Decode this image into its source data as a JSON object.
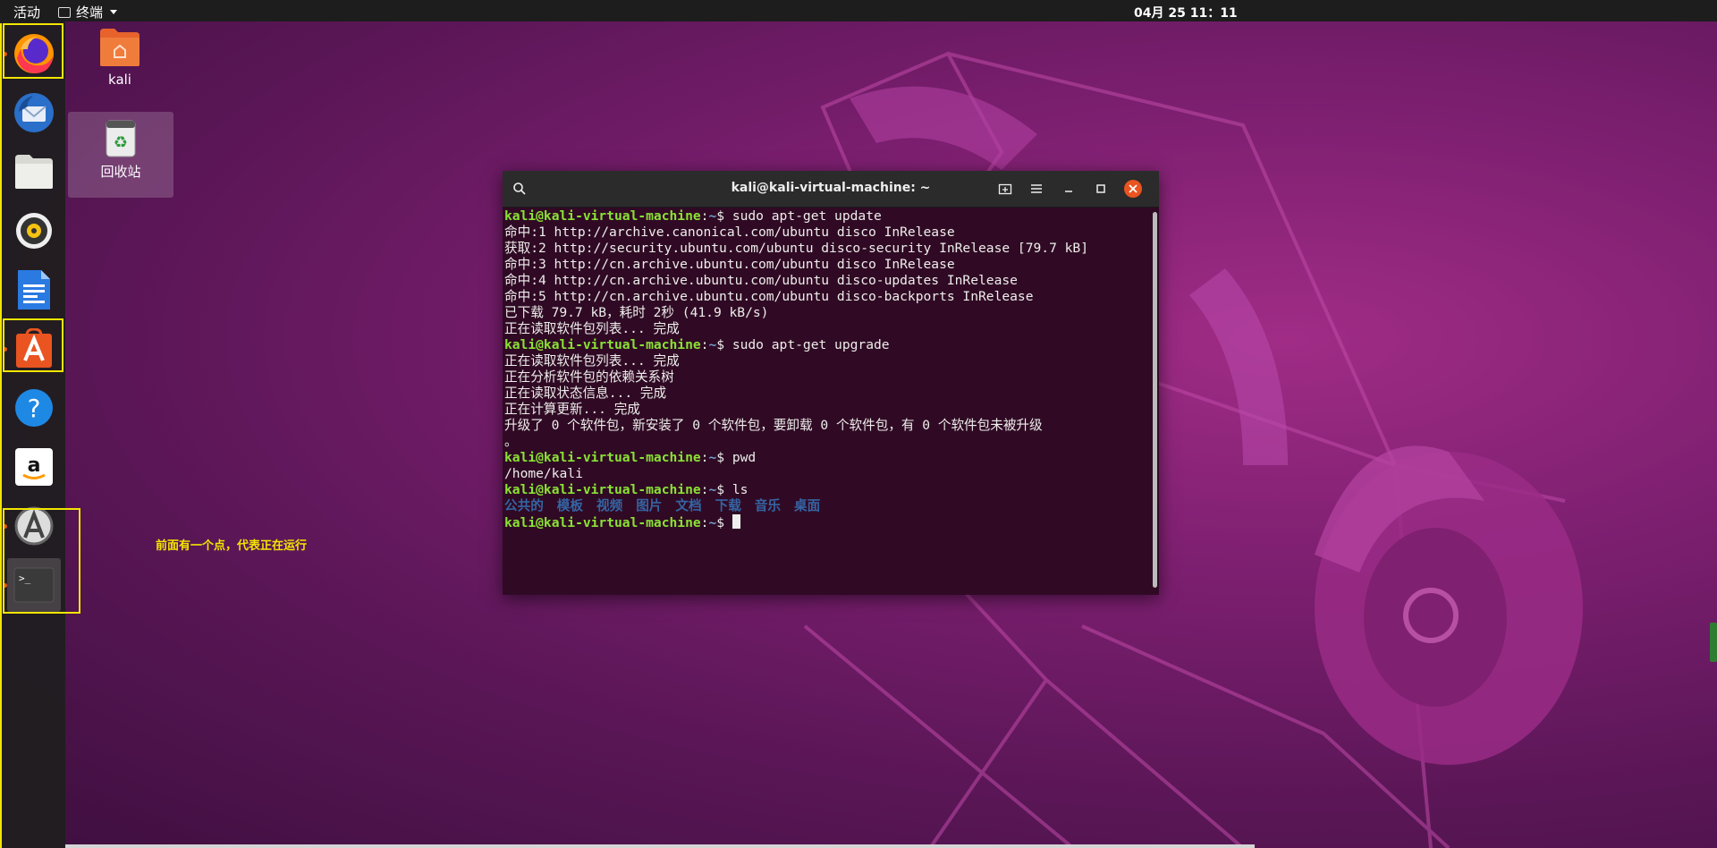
{
  "topbar": {
    "activities": "活动",
    "app_menu": "终端",
    "clock": "04月 25  11：11"
  },
  "dock": {
    "items": [
      {
        "name": "firefox",
        "icon": "firefox-icon",
        "running": true
      },
      {
        "name": "thunderbird",
        "icon": "thunderbird-icon",
        "running": false
      },
      {
        "name": "files",
        "icon": "folder-icon",
        "running": false
      },
      {
        "name": "rhythmbox",
        "icon": "rhythmbox-icon",
        "running": false
      },
      {
        "name": "libreoffice-writer",
        "icon": "writer-icon",
        "running": false
      },
      {
        "name": "ubuntu-software",
        "icon": "software-center-icon",
        "running": true
      },
      {
        "name": "help",
        "icon": "help-icon",
        "running": false
      },
      {
        "name": "amazon",
        "icon": "amazon-icon",
        "running": false
      },
      {
        "name": "software-updater",
        "icon": "updater-icon",
        "running": true
      },
      {
        "name": "terminal",
        "icon": "terminal-icon",
        "running": true
      }
    ]
  },
  "desktop": {
    "icons": [
      {
        "label": "kali",
        "icon": "home-folder-icon"
      },
      {
        "label": "回收站",
        "icon": "trash-icon"
      }
    ],
    "annotation": "前面有一个点，代表正在运行"
  },
  "terminal": {
    "title": "kali@kali-virtual-machine: ~",
    "prompt_user": "kali@kali-virtual-machine",
    "prompt_path": "~",
    "prompt_sign": "$ ",
    "lines": [
      {
        "type": "cmd",
        "text": "sudo apt-get update"
      },
      {
        "type": "out",
        "text": "命中:1 http://archive.canonical.com/ubuntu disco InRelease"
      },
      {
        "type": "out",
        "text": "获取:2 http://security.ubuntu.com/ubuntu disco-security InRelease [79.7 kB]"
      },
      {
        "type": "out",
        "text": "命中:3 http://cn.archive.ubuntu.com/ubuntu disco InRelease"
      },
      {
        "type": "out",
        "text": "命中:4 http://cn.archive.ubuntu.com/ubuntu disco-updates InRelease"
      },
      {
        "type": "out",
        "text": "命中:5 http://cn.archive.ubuntu.com/ubuntu disco-backports InRelease"
      },
      {
        "type": "out",
        "text": "已下载 79.7 kB，耗时 2秒 (41.9 kB/s)"
      },
      {
        "type": "out",
        "text": "正在读取软件包列表... 完成"
      },
      {
        "type": "cmd",
        "text": "sudo apt-get upgrade"
      },
      {
        "type": "out",
        "text": "正在读取软件包列表... 完成"
      },
      {
        "type": "out",
        "text": "正在分析软件包的依赖关系树"
      },
      {
        "type": "out",
        "text": "正在读取状态信息... 完成"
      },
      {
        "type": "out",
        "text": "正在计算更新... 完成"
      },
      {
        "type": "out",
        "text": "升级了 0 个软件包，新安装了 0 个软件包，要卸载 0 个软件包，有 0 个软件包未被升级"
      },
      {
        "type": "out",
        "text": "。"
      },
      {
        "type": "cmd",
        "text": "pwd"
      },
      {
        "type": "out",
        "text": "/home/kali"
      },
      {
        "type": "cmd",
        "text": "ls"
      },
      {
        "type": "dirs",
        "items": [
          "公共的",
          "模板",
          "视频",
          "图片",
          "文档",
          "下载",
          "音乐",
          "桌面"
        ]
      },
      {
        "type": "cursor"
      }
    ]
  },
  "colors": {
    "accent": "#e95420",
    "highlight": "#f2e600",
    "terminal_bg": "#300a24",
    "prompt_user": "#8ae234",
    "prompt_path": "#729fcf",
    "dir": "#3465a4"
  }
}
